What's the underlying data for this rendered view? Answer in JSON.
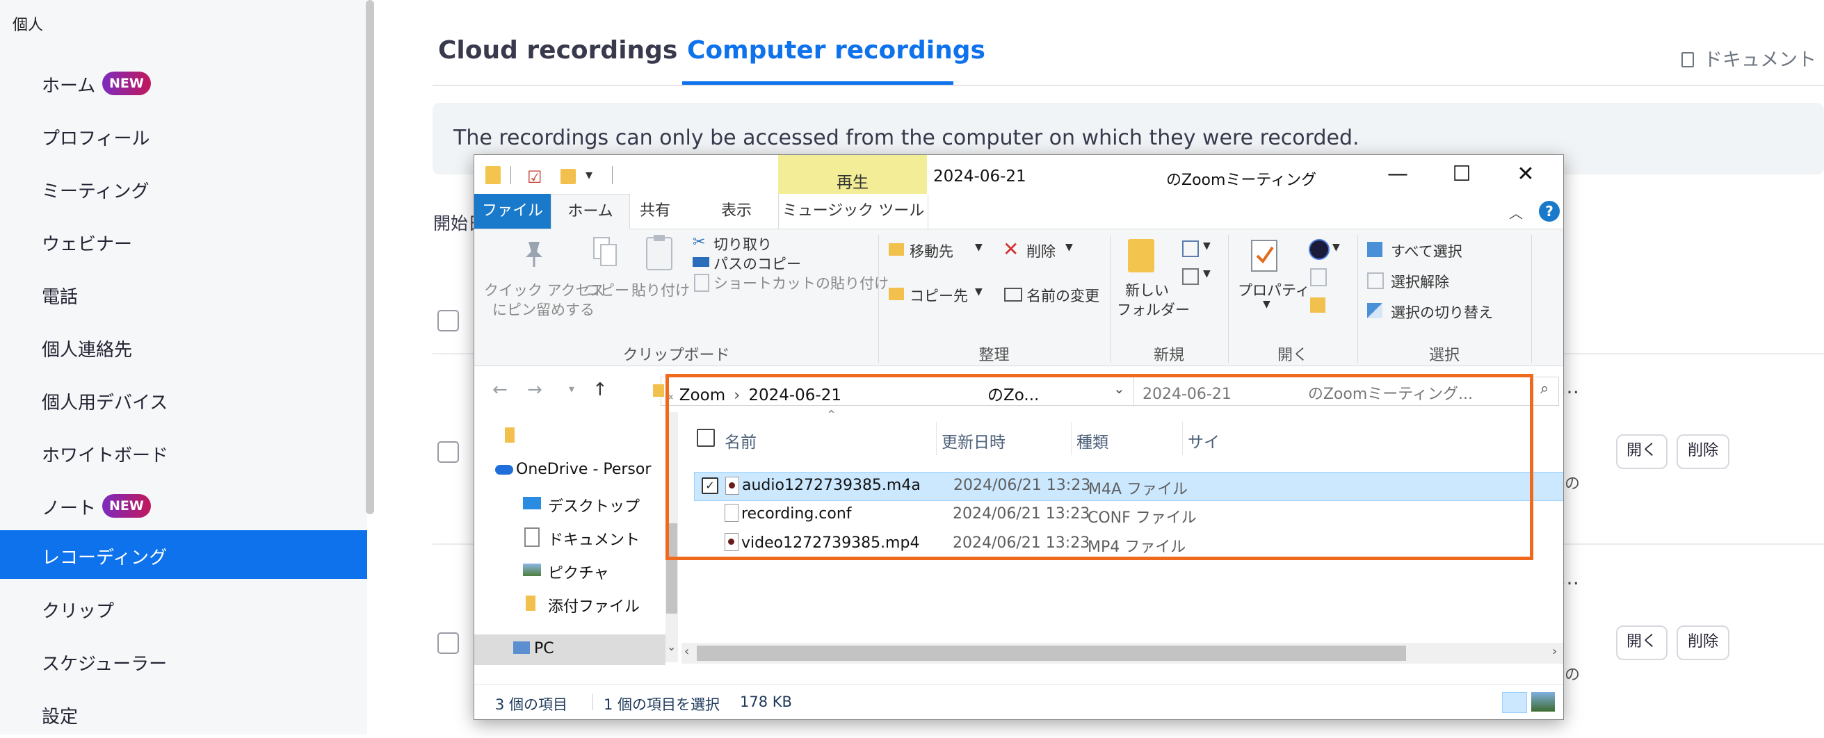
{
  "sidebar": {
    "section_title": "個人",
    "items": [
      {
        "label": "ホーム",
        "badge": "NEW"
      },
      {
        "label": "プロフィール"
      },
      {
        "label": "ミーティング"
      },
      {
        "label": "ウェビナー"
      },
      {
        "label": "電話"
      },
      {
        "label": "個人連絡先"
      },
      {
        "label": "個人用デバイス"
      },
      {
        "label": "ホワイトボード"
      },
      {
        "label": "ノート",
        "badge": "NEW"
      },
      {
        "label": "レコーディング",
        "active": true
      },
      {
        "label": "クリップ"
      },
      {
        "label": "スケジューラー"
      },
      {
        "label": "設定"
      }
    ]
  },
  "main": {
    "tabs": [
      {
        "label": "Cloud recordings"
      },
      {
        "label": "Computer recordings",
        "active": true
      }
    ],
    "doc_link": "ドキュメント",
    "notice": "The recordings can only be accessed from the computer on which they were recorded.",
    "start_label": "開始日",
    "row_open": "開く",
    "row_delete": "削除",
    "more": "…",
    "edge_char": "の"
  },
  "explorer": {
    "context_tab": "再生",
    "title_date": "2024-06-21",
    "title_name": "のZoomミーティング",
    "ribbon_tabs": [
      "ファイル",
      "ホーム",
      "共有",
      "表示",
      "ミュージック ツール"
    ],
    "clipboard": {
      "pin_line1": "クイック アクセス",
      "pin_line2": "にピン留めする",
      "copy": "コピー",
      "paste": "貼り付け",
      "cut": "切り取り",
      "copy_path": "パスのコピー",
      "paste_shortcut": "ショートカットの貼り付け",
      "group": "クリップボード"
    },
    "organize": {
      "move_to": "移動先",
      "copy_to": "コピー先",
      "delete": "削除",
      "rename": "名前の変更",
      "group": "整理"
    },
    "new": {
      "folder_line1": "新しい",
      "folder_line2": "フォルダー",
      "group": "新規"
    },
    "open": {
      "properties": "プロパティ",
      "group": "開く"
    },
    "select": {
      "all": "すべて選択",
      "none": "選択解除",
      "invert": "選択の切り替え",
      "group": "選択"
    },
    "address": {
      "path": [
        "Zoom",
        "2024-06-21",
        "のZo..."
      ],
      "search_placeholder_date": "2024-06-21",
      "search_placeholder_name": "のZoomミーティング..."
    },
    "nav": [
      {
        "label": ""
      },
      {
        "label": "OneDrive - Persor"
      },
      {
        "label": "デスクトップ"
      },
      {
        "label": "ドキュメント"
      },
      {
        "label": "ピクチャ"
      },
      {
        "label": "添付ファイル"
      },
      {
        "label": "PC"
      }
    ],
    "columns": {
      "name": "名前",
      "modified": "更新日時",
      "type": "種類",
      "size": "サイ"
    },
    "files": [
      {
        "name": "audio1272739385.m4a",
        "modified": "2024/06/21 13:23",
        "type": "M4A ファイル",
        "selected": true
      },
      {
        "name": "recording.conf",
        "modified": "2024/06/21 13:23",
        "type": "CONF ファイル",
        "selected": false
      },
      {
        "name": "video1272739385.mp4",
        "modified": "2024/06/21 13:23",
        "type": "MP4 ファイル",
        "selected": false
      }
    ],
    "status": {
      "count": "3 個の項目",
      "selection": "1 個の項目を選択",
      "size": "178 KB"
    }
  },
  "colors": {
    "accent": "#0e72ed",
    "highlight": "#f06a1d",
    "explorer_blue": "#1979ca"
  }
}
